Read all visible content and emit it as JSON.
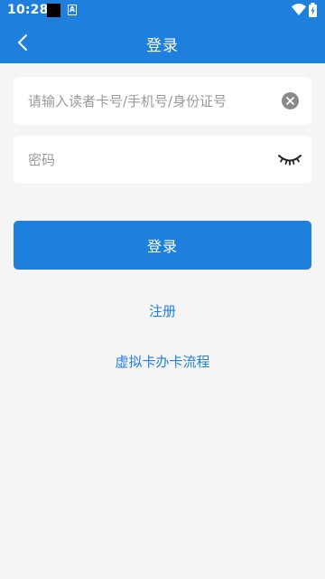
{
  "status_bar": {
    "time": "10:28"
  },
  "app_bar": {
    "title": "登录"
  },
  "form": {
    "account_placeholder": "请输入读者卡号/手机号/身份证号",
    "account_value": "",
    "password_placeholder": "密码",
    "password_value": "",
    "submit_label": "登录"
  },
  "links": {
    "register": "注册",
    "virtual_card": "虚拟卡办卡流程"
  },
  "colors": {
    "primary": "#1e7fdc",
    "background": "#f5f5f5"
  },
  "icons": [
    "back-arrow-icon",
    "clear-icon",
    "eye-closed-icon",
    "wifi-icon",
    "battery-icon"
  ]
}
